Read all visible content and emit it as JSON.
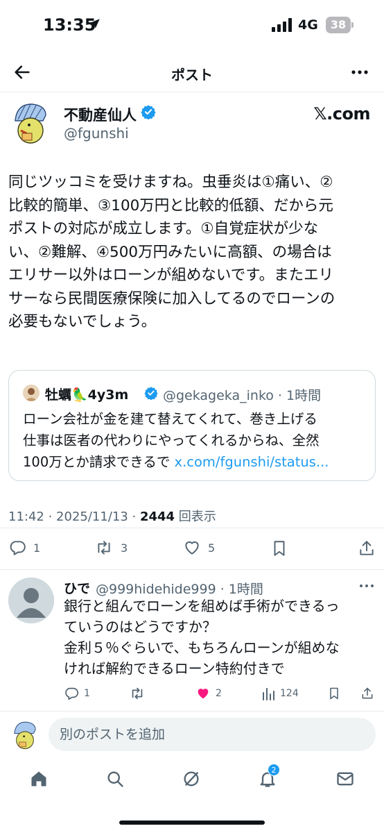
{
  "status_bar": {
    "time": "13:35",
    "network": "4G",
    "battery": "38"
  },
  "nav": {
    "title": "ポスト"
  },
  "post": {
    "author_name": "不動産仙人",
    "author_handle": "@fgunshi",
    "source_label": "𝕏.com",
    "body_lines": [
      "同じツッコミを受けますね。虫垂炎は①痛い、②",
      "比較的簡単、③100万円と比較的低額、だから元",
      "ポストの対応が成立します。①自覚症状が少な",
      "い、②難解、④500万円みたいに高額、の場合は",
      "エリサー以外はローンが組めないです。またエリ",
      "サーなら民間医療保険に加入してるのでローンの",
      "必要もないでしょう。"
    ],
    "quote": {
      "name": "牡蠣🦜4y3m",
      "handle_time": "@gekageka_inko · 1時間",
      "lines": [
        "ローン会社が金を建て替えてくれて、巻き上げる",
        "仕事は医者の代わりにやってくれるからね、全然"
      ],
      "last_line_prefix": "100万とか請求できるで ",
      "link": "x.com/fgunshi/status..."
    },
    "meta": {
      "time_date": "11:42 · 2025/11/13 · ",
      "views": "2444",
      "views_label": " 回表示"
    },
    "counts": {
      "replies": "1",
      "reposts": "3",
      "likes": "5"
    }
  },
  "reply": {
    "name": "ひで",
    "handle_time": "@999hidehide999 · 1時間",
    "lines": [
      "銀行と組んでローンを組めば手術ができるっ",
      "ていうのはどうですか？",
      "金利５％ぐらいで、もちろんローンが組めな",
      "ければ解約できるローン特約付きで"
    ],
    "counts": {
      "replies": "1",
      "reposts": "",
      "likes": "2",
      "views": "124"
    }
  },
  "compose": {
    "placeholder": "別のポストを追加"
  },
  "tabbar": {
    "notifications_badge": "2"
  },
  "colors": {
    "accent": "#1d9bf0",
    "like": "#f91880",
    "text": "#0f1419",
    "muted": "#536471"
  }
}
